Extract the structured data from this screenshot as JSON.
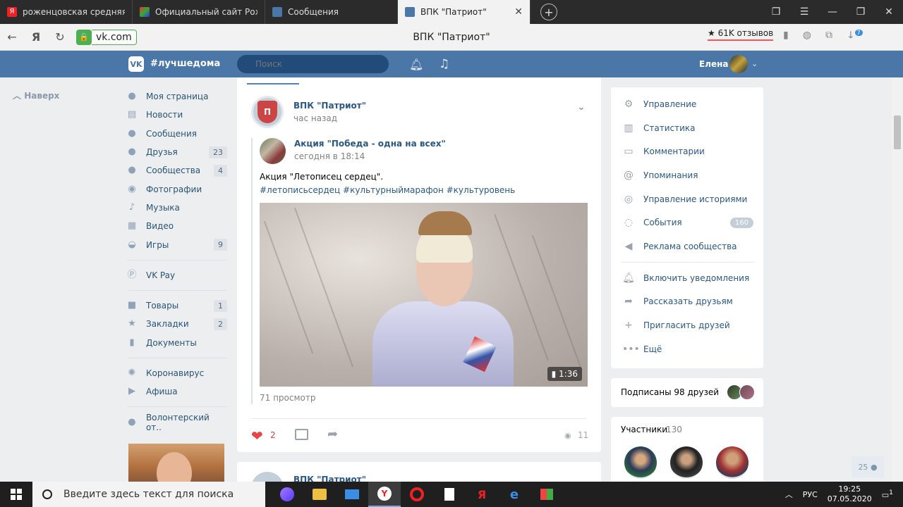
{
  "browser": {
    "tabs": [
      {
        "label": "роженцовская средняя ш",
        "icon": "yandex-icon",
        "active": false
      },
      {
        "label": "Официальный сайт Рожен",
        "icon": "site-icon",
        "active": false
      },
      {
        "label": "Сообщения",
        "icon": "vk-message-icon",
        "active": false
      },
      {
        "label": "ВПК \"Патриот\"",
        "icon": "vk-icon",
        "active": true
      }
    ],
    "tab_close": "✕",
    "new_tab": "+",
    "url": "vk.com",
    "page_title": "ВПК \"Патриот\"",
    "reviews": "★ 61K отзывов",
    "downloads_badge": "7"
  },
  "vk_header": {
    "logo": "VK",
    "hashtag": "#лучшедома",
    "search_placeholder": "Поиск",
    "user_name": "Елена"
  },
  "back_link": "Наверх",
  "left_nav": [
    {
      "label": "Моя страница",
      "icon": "user-icon"
    },
    {
      "label": "Новости",
      "icon": "news-icon"
    },
    {
      "label": "Сообщения",
      "icon": "message-icon"
    },
    {
      "label": "Друзья",
      "icon": "friends-icon",
      "count": "23"
    },
    {
      "label": "Сообщества",
      "icon": "groups-icon",
      "count": "4"
    },
    {
      "label": "Фотографии",
      "icon": "camera-icon"
    },
    {
      "label": "Музыка",
      "icon": "music-icon"
    },
    {
      "label": "Видео",
      "icon": "video-icon"
    },
    {
      "label": "Игры",
      "icon": "gamepad-icon",
      "count": "9"
    }
  ],
  "left_nav_2": [
    {
      "label": "VK Pay",
      "icon": "vkpay-icon"
    }
  ],
  "left_nav_3": [
    {
      "label": "Товары",
      "icon": "bag-icon",
      "count": "1"
    },
    {
      "label": "Закладки",
      "icon": "star-icon",
      "count": "2"
    },
    {
      "label": "Документы",
      "icon": "document-icon"
    }
  ],
  "left_nav_4": [
    {
      "label": "Коронавирус",
      "icon": "virus-icon"
    },
    {
      "label": "Афиша",
      "icon": "poster-icon"
    }
  ],
  "left_nav_5": [
    {
      "label": "Волонтерский от..",
      "icon": "volunteer-icon"
    }
  ],
  "post": {
    "author": "ВПК \"Патриот\"",
    "time": "час назад",
    "repost": {
      "author": "Акция \"Победа - одна на всех\"",
      "time": "сегодня в 18:14",
      "text": "Акция \"Летописец сердец\".",
      "tags": "#летописьсердец #культурныймарафон #культуровень",
      "video_duration": "1:36",
      "views": "71 просмотр"
    },
    "likes": "2",
    "views": "11"
  },
  "post2": {
    "author": "ВПК \"Патриот\""
  },
  "right_menu": [
    {
      "label": "Управление",
      "icon": "gear-icon"
    },
    {
      "label": "Статистика",
      "icon": "stats-icon"
    },
    {
      "label": "Комментарии",
      "icon": "comment-icon"
    },
    {
      "label": "Упоминания",
      "icon": "at-icon"
    },
    {
      "label": "Управление историями",
      "icon": "stories-icon"
    },
    {
      "label": "События",
      "icon": "events-icon",
      "count": "160"
    },
    {
      "label": "Реклама сообщества",
      "icon": "megaphone-icon"
    }
  ],
  "right_menu_2": [
    {
      "label": "Включить уведомления",
      "icon": "bell-icon"
    },
    {
      "label": "Рассказать друзьям",
      "icon": "share-icon"
    },
    {
      "label": "Пригласить друзей",
      "icon": "invite-icon"
    },
    {
      "label": "Ещё",
      "icon": "more-icon"
    }
  ],
  "friends_subscribed": "Подписаны 98 друзей",
  "members": {
    "title": "Участники",
    "count": "130"
  },
  "online_count": "25",
  "taskbar": {
    "search_placeholder": "Введите здесь текст для поиска",
    "lang": "РУС",
    "time": "19:25",
    "date": "07.05.2020",
    "notifications": "1"
  },
  "colors": {
    "vk_blue": "#4a76a8",
    "link": "#2a5885",
    "like_red": "#e64646"
  }
}
